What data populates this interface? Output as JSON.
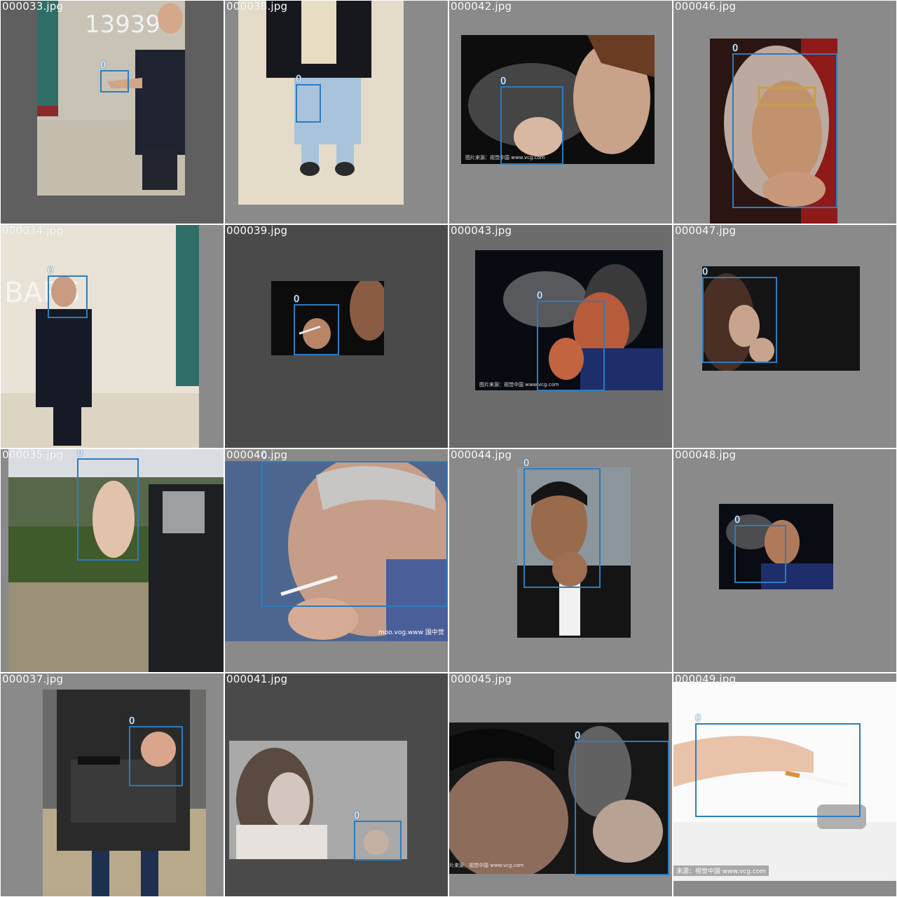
{
  "colors": {
    "box": "#2e7bbd",
    "label": "#ffffff"
  },
  "tiles": [
    {
      "file": "000033.jpg",
      "label": "0"
    },
    {
      "file": "000038.jpg",
      "label": "0"
    },
    {
      "file": "000042.jpg",
      "label": "0",
      "watermark": "图片来源：视觉中国 www.vcg.com"
    },
    {
      "file": "000046.jpg",
      "label": "0"
    },
    {
      "file": "000034.jpg",
      "label": "0"
    },
    {
      "file": "000039.jpg",
      "label": "0"
    },
    {
      "file": "000043.jpg",
      "label": "0",
      "watermark": "图片来源：视觉中国 www.vcg.com"
    },
    {
      "file": "000047.jpg",
      "label": "0"
    },
    {
      "file": "000035.jpg",
      "label": "0"
    },
    {
      "file": "000040.jpg",
      "label": "0",
      "watermark": "moo.vog.www 国中觉"
    },
    {
      "file": "000044.jpg",
      "label": "0"
    },
    {
      "file": "000048.jpg",
      "label": "0"
    },
    {
      "file": "000037.jpg",
      "label": "0"
    },
    {
      "file": "000041.jpg",
      "label": "0"
    },
    {
      "file": "000045.jpg",
      "label": "0",
      "watermark": "片来源：视觉中国 www.vcg.com"
    },
    {
      "file": "000049.jpg",
      "label": "0",
      "watermark": "来源：视觉中国 www.vcg.com"
    }
  ]
}
